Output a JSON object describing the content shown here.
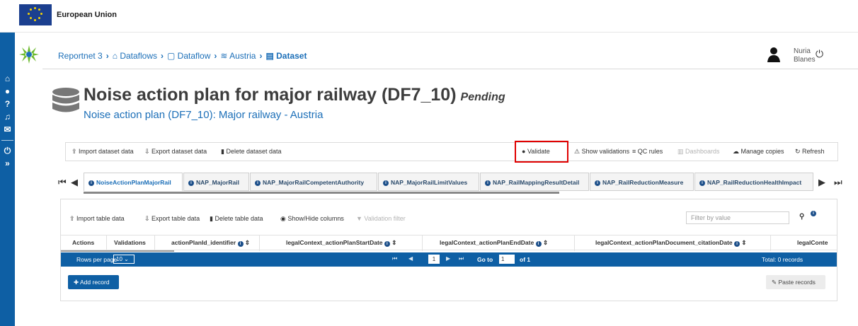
{
  "eu": {
    "label": "European Union"
  },
  "breadcrumb": [
    {
      "label": "Reportnet 3"
    },
    {
      "label": "Dataflows"
    },
    {
      "label": "Dataflow"
    },
    {
      "label": "Austria"
    },
    {
      "label": "Dataset"
    }
  ],
  "user": {
    "first": "Nuria",
    "last": "Blanes"
  },
  "dataset": {
    "title": "Noise action plan for major railway (DF7_10)",
    "status": "Pending",
    "subtitle": "Noise action plan (DF7_10): Major railway - Austria"
  },
  "dataset_toolbar": {
    "import": "Import dataset data",
    "export": "Export dataset data",
    "delete": "Delete dataset data",
    "validate": "Validate",
    "show_validations": "Show validations",
    "qc_rules": "QC rules",
    "dashboards": "Dashboards",
    "manage_copies": "Manage copies",
    "refresh": "Refresh"
  },
  "tabs": [
    {
      "label": "NoiseActionPlanMajorRail",
      "active": true
    },
    {
      "label": "NAP_MajorRail"
    },
    {
      "label": "NAP_MajorRailCompetentAuthority"
    },
    {
      "label": "NAP_MajorRailLimitValues"
    },
    {
      "label": "NAP_RailMappingResultDetail"
    },
    {
      "label": "NAP_RailReductionMeasure"
    },
    {
      "label": "NAP_RailReductionHealthImpact"
    }
  ],
  "table_toolbar": {
    "import": "Import table data",
    "export": "Export table data",
    "delete": "Delete table data",
    "show_hide": "Show/Hide columns",
    "validation_filter": "Validation filter",
    "filter_placeholder": "Filter by value"
  },
  "columns": [
    "Actions",
    "Validations",
    "actionPlanId_identifier",
    "legalContext_actionPlanStartDate",
    "legalContext_actionPlanEndDate",
    "legalContext_actionPlanDocument_citationDate",
    "legalConte"
  ],
  "pager": {
    "rows_per_page": "Rows per page",
    "rows_value": "10",
    "page": "1",
    "goto": "Go to",
    "goto_value": "1",
    "of": "of 1",
    "total": "Total: 0 records"
  },
  "actions": {
    "add_record": "Add record",
    "paste_records": "Paste records"
  },
  "colors": {
    "primary": "#0e5fa4",
    "link": "#1c6fb8",
    "highlight": "#e00000"
  }
}
